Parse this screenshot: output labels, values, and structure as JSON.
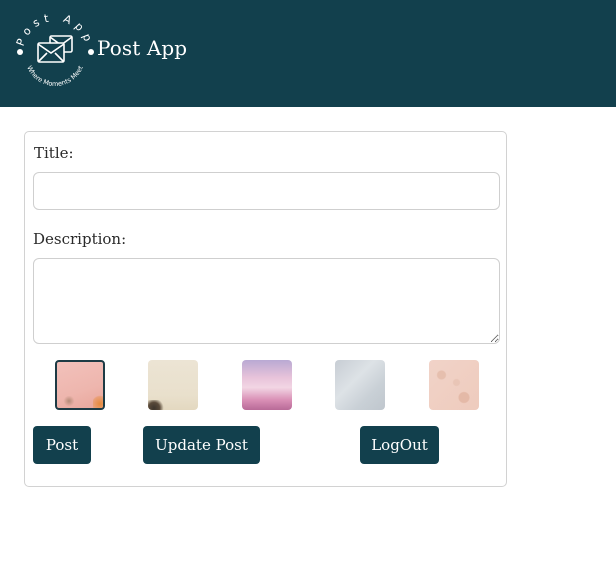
{
  "header": {
    "logo_ring_text": "Post App",
    "logo_tagline": "Where Moments Meet",
    "app_title": "Post App",
    "background": "#12404d"
  },
  "form": {
    "title_label": "Title:",
    "title_value": "",
    "description_label": "Description:",
    "description_value": "",
    "backgrounds": [
      {
        "name": "pink",
        "selected": true
      },
      {
        "name": "cream",
        "selected": false
      },
      {
        "name": "lavender-pink",
        "selected": false
      },
      {
        "name": "gray-blue",
        "selected": false
      },
      {
        "name": "peach",
        "selected": false
      }
    ]
  },
  "actions": {
    "post_label": "Post",
    "update_label": "Update Post",
    "logout_label": "LogOut"
  },
  "colors": {
    "primary": "#12404d",
    "border": "#d2d2d2"
  }
}
